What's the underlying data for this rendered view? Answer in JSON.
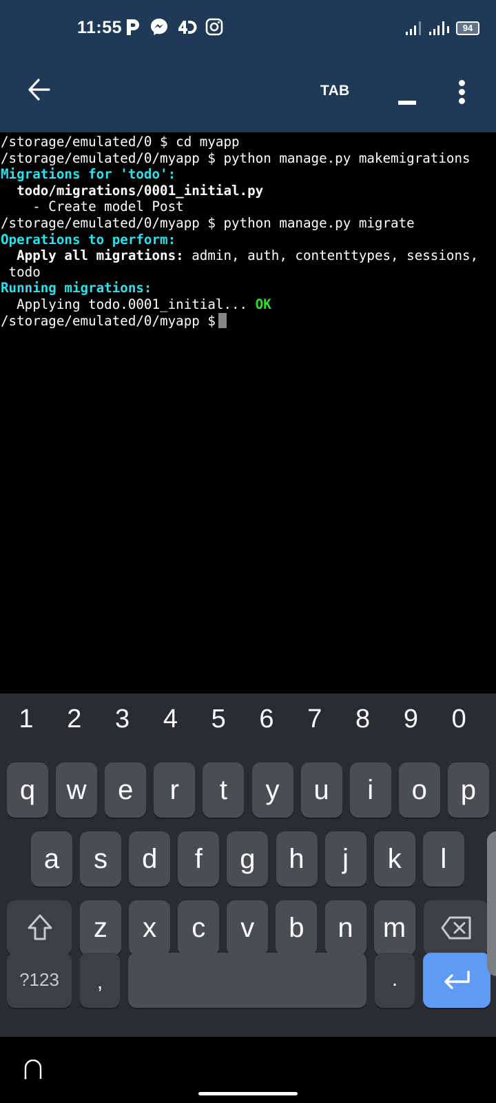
{
  "status_bar": {
    "time": "11:55",
    "notification_icons": [
      "pinterest-icon",
      "messenger-icon",
      "4d-app-icon",
      "instagram-icon"
    ],
    "signal_icons": [
      "signal-sim1-icon",
      "signal-sim2-icon"
    ],
    "battery_level": "94"
  },
  "toolbar": {
    "back_icon": "arrow-left-icon",
    "tab_label": "TAB",
    "underscore_label": "_",
    "more_icon": "more-vertical-icon"
  },
  "terminal": {
    "lines": [
      {
        "segments": [
          {
            "text": "/storage/emulated/0 $ cd myapp",
            "style": "plain"
          }
        ]
      },
      {
        "segments": [
          {
            "text": "/storage/emulated/0/myapp $ python manage.py makemigrations",
            "style": "plain"
          }
        ]
      },
      {
        "segments": [
          {
            "text": "Migrations for 'todo':",
            "style": "cyan-bold"
          }
        ]
      },
      {
        "segments": [
          {
            "text": "  todo/migrations/0001_initial.py",
            "style": "bold"
          }
        ]
      },
      {
        "segments": [
          {
            "text": "    - Create model Post",
            "style": "plain"
          }
        ]
      },
      {
        "segments": [
          {
            "text": "/storage/emulated/0/myapp $ python manage.py migrate",
            "style": "plain"
          }
        ]
      },
      {
        "segments": [
          {
            "text": "Operations to perform:",
            "style": "cyan-bold"
          }
        ]
      },
      {
        "segments": [
          {
            "text": "  Apply all migrations:",
            "style": "bold"
          },
          {
            "text": " admin, auth, contenttypes, sessions,",
            "style": "plain"
          }
        ]
      },
      {
        "segments": [
          {
            "text": " todo",
            "style": "plain"
          }
        ]
      },
      {
        "segments": [
          {
            "text": "Running migrations:",
            "style": "cyan-bold"
          }
        ]
      },
      {
        "segments": [
          {
            "text": "  Applying todo.0001_initial...",
            "style": "plain"
          },
          {
            "text": " OK",
            "style": "green-bold"
          }
        ]
      },
      {
        "segments": [
          {
            "text": "/storage/emulated/0/myapp $",
            "style": "plain"
          }
        ],
        "cursor": true
      }
    ]
  },
  "keyboard": {
    "number_row": [
      "1",
      "2",
      "3",
      "4",
      "5",
      "6",
      "7",
      "8",
      "9",
      "0"
    ],
    "row1": [
      "q",
      "w",
      "e",
      "r",
      "t",
      "y",
      "u",
      "i",
      "o",
      "p"
    ],
    "row2": [
      "a",
      "s",
      "d",
      "f",
      "g",
      "h",
      "j",
      "k",
      "l"
    ],
    "row3": [
      "z",
      "x",
      "c",
      "v",
      "b",
      "n",
      "m"
    ],
    "shift_icon": "shift-icon",
    "backspace_icon": "backspace-icon",
    "symbols_label": "?123",
    "comma_label": ",",
    "space_label": "",
    "period_label": ".",
    "enter_icon": "enter-icon",
    "enter_color": "#5f9af5"
  },
  "nav_bar": {
    "keyboard_hide_icon": "keyboard-hide-icon",
    "home_indicator": "home-indicator"
  }
}
